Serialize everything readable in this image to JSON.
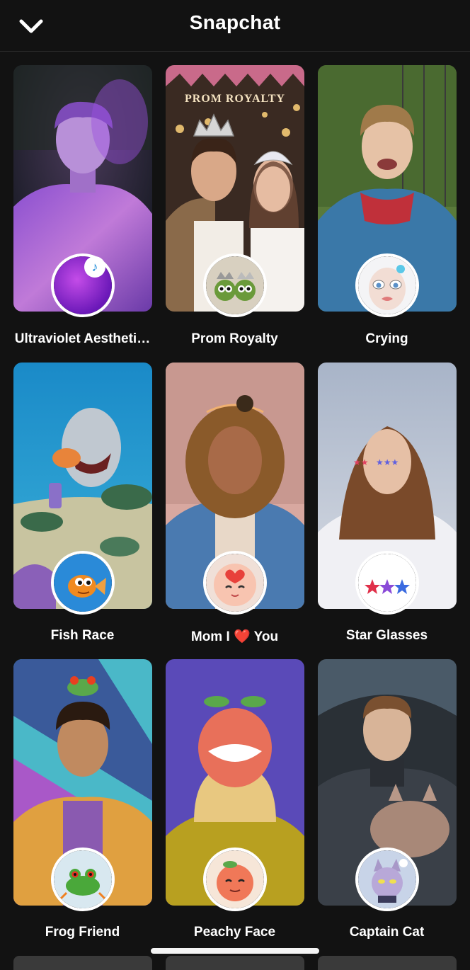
{
  "header": {
    "title": "Snapchat",
    "back_icon": "chevron-down-icon"
  },
  "lenses": [
    {
      "name": "Ultraviolet Aestheti…",
      "badge_icon": "purple-gradient-icon",
      "has_music": true
    },
    {
      "name": "Prom Royalty",
      "badge_icon": "prom-royalty-faces-icon"
    },
    {
      "name": "Crying",
      "badge_icon": "crying-face-icon"
    },
    {
      "name": "Fish Race",
      "badge_icon": "goldfish-icon"
    },
    {
      "name": "Mom I ❤️ You",
      "badge_icon": "heart-face-icon"
    },
    {
      "name": "Star Glasses",
      "badge_icon": "star-glasses-icon"
    },
    {
      "name": "Frog Friend",
      "badge_icon": "frog-icon"
    },
    {
      "name": "Peachy Face",
      "badge_icon": "peach-face-icon"
    },
    {
      "name": "Captain Cat",
      "badge_icon": "captain-cat-icon"
    }
  ],
  "overlay_text": {
    "prom_banner": "PROM ROYALTY"
  },
  "music_badge": "♪"
}
